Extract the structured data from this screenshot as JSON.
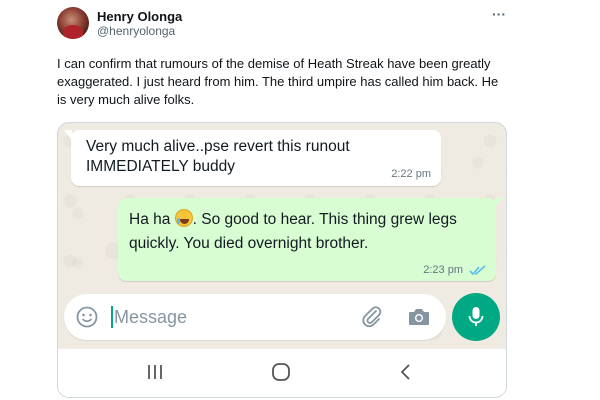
{
  "author": {
    "name": "Henry Olonga",
    "handle": "@henryolonga"
  },
  "tweet": {
    "text": "I can confirm that rumours of the demise of Heath Streak have been greatly exaggerated.  I just heard from him. The third umpire has called him back. He is very much alive folks."
  },
  "chat": {
    "incoming": {
      "text": "Very much alive..pse revert this runout IMMEDIATELY buddy",
      "time": "2:22 pm"
    },
    "outgoing": {
      "text_before_emoji": "Ha ha ",
      "emoji": "tears-of-joy",
      "text_after_emoji": ".  So good to hear. This thing grew legs quickly. You died overnight brother.",
      "time": "2:23 pm",
      "status": "read"
    },
    "input": {
      "placeholder": "Message"
    }
  },
  "colors": {
    "chat_background": "#efeae2",
    "outgoing_bubble": "#d9fdd3",
    "accent": "#00a884",
    "read_ticks": "#53bdeb"
  },
  "icons": {
    "more": "more-horizontal-icon",
    "emoji": "smiley-icon",
    "attach": "paperclip-icon",
    "camera": "camera-icon",
    "mic": "microphone-icon",
    "nav": [
      "recent-apps-icon",
      "home-icon",
      "back-icon"
    ]
  }
}
